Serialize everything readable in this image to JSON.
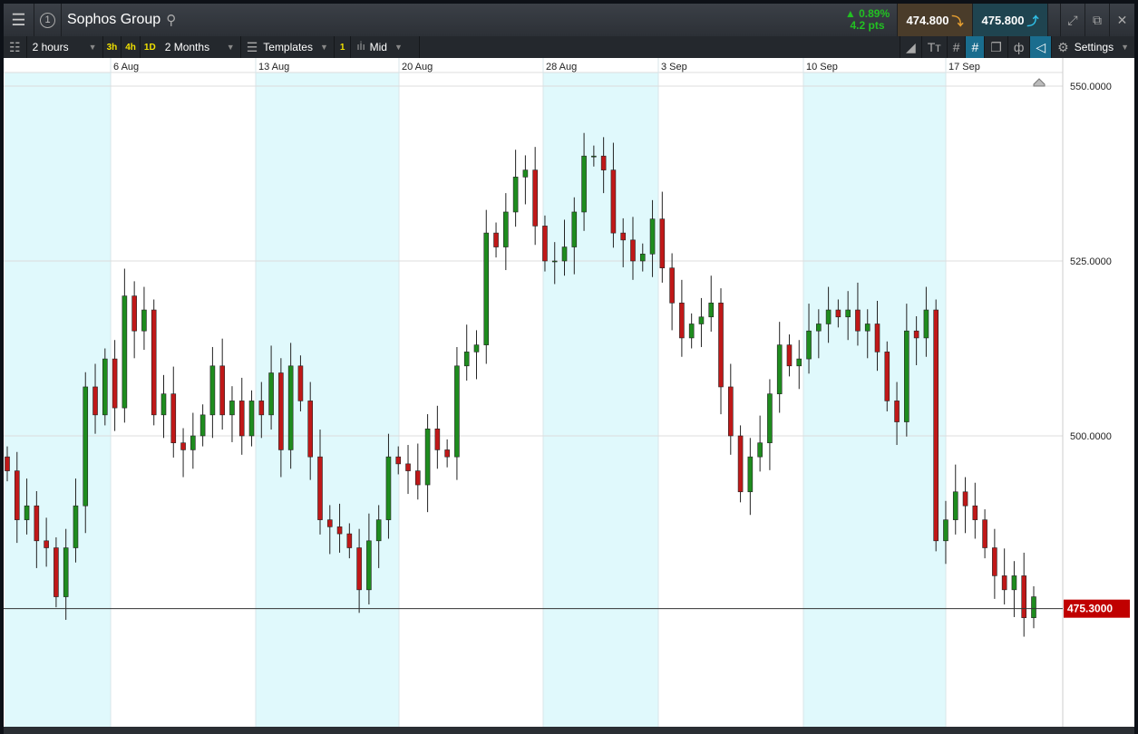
{
  "header": {
    "title": "Sophos Group",
    "window_number": "1",
    "change_pct": "0.89%",
    "change_pts": "4.2 pts",
    "sell": "474.800",
    "buy": "475.800"
  },
  "toolbar": {
    "interval": "2 hours",
    "quick": [
      "3h",
      "4h",
      "1D"
    ],
    "range": "2 Months",
    "templates": "Templates",
    "badge": "1",
    "price_type": "Mid",
    "settings": "Settings"
  },
  "colors": {
    "up": "#1e8c1e",
    "down": "#c01818",
    "band": "#e0f9fc",
    "accent": "#1a6d8e"
  },
  "chart_data": {
    "type": "candlestick",
    "x_labels": [
      "6 Aug",
      "13 Aug",
      "20 Aug",
      "28 Aug",
      "3 Sep",
      "10 Sep",
      "17 Sep"
    ],
    "y_ticks": [
      "550.0000",
      "525.0000",
      "500.0000"
    ],
    "y_tick_values": [
      550,
      525,
      500
    ],
    "ylim": [
      468,
      556
    ],
    "current_price": 475.3,
    "current_price_label": "475.3000",
    "closes": [
      495,
      488,
      490,
      485,
      484,
      477,
      484,
      490,
      507,
      503,
      511,
      504,
      520,
      515,
      518,
      503,
      506,
      499,
      498,
      500,
      503,
      510,
      503,
      505,
      500,
      505,
      503,
      509,
      498,
      510,
      505,
      497,
      488,
      487,
      486,
      484,
      478,
      485,
      488,
      497,
      496,
      495,
      493,
      501,
      498,
      497,
      510,
      512,
      513,
      529,
      527,
      532,
      537,
      538,
      530,
      525,
      525,
      527,
      532,
      540,
      540,
      538,
      529,
      528,
      525,
      526,
      531,
      524,
      519,
      514,
      516,
      517,
      519,
      507,
      500,
      492,
      497,
      499,
      506,
      513,
      510,
      511,
      515,
      516,
      518,
      517,
      518,
      515,
      516,
      512,
      505,
      502,
      515,
      514,
      518,
      485,
      488,
      492,
      490,
      488,
      484,
      480,
      478,
      480,
      474,
      477
    ]
  }
}
